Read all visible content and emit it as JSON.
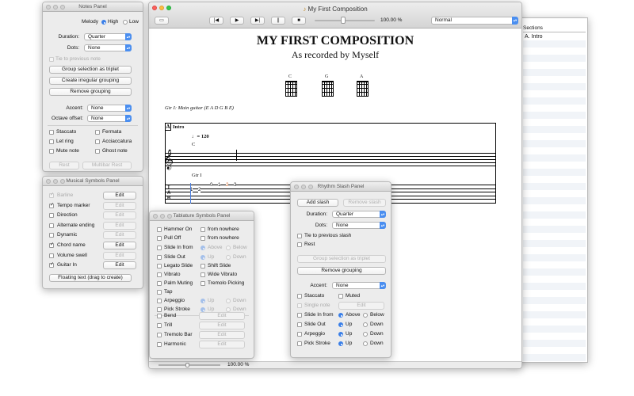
{
  "main": {
    "title": "My First Composition",
    "tempo": "100.00 %",
    "view": "Normal",
    "zoom": "100.00 %"
  },
  "score": {
    "title": "MY FIRST COMPOSITION",
    "subtitle": "As recorded by Myself",
    "chords": [
      "C",
      "G",
      "A"
    ],
    "track": "Gtr I: Main guitar (E A D G B E)",
    "section": "A",
    "section_name": "Intro",
    "tempo_mark": "♩= 120",
    "chord_c": "C",
    "staff_label": "Gtr I",
    "tab_letters": [
      "T",
      "A",
      "B"
    ],
    "frets": [
      "1",
      "2",
      "0",
      "1",
      "2",
      "3"
    ]
  },
  "sections": {
    "header": "Sections",
    "items": [
      "A. Intro"
    ]
  },
  "notes_panel": {
    "title": "Notes Panel",
    "melody": "Melody",
    "high": "High",
    "low": "Low",
    "duration": "Duration:",
    "duration_val": "Quarter",
    "dots": "Dots:",
    "dots_val": "None",
    "tie": "Tie to previous note",
    "group_triplet": "Group selection as triplet",
    "irregular": "Create irregular grouping",
    "remove": "Remove grouping",
    "accent": "Accent:",
    "accent_val": "None",
    "octave": "Octave offset:",
    "octave_val": "None",
    "staccato": "Staccato",
    "fermata": "Fermata",
    "letring": "Let ring",
    "acciaccatura": "Acciaccatura",
    "mute": "Mute note",
    "ghost": "Ghost note",
    "rest": "Rest",
    "multibar": "Multibar Rest"
  },
  "symbols_panel": {
    "title": "Musical Symbols Panel",
    "items": [
      "Barline",
      "Tempo marker",
      "Direction",
      "Alternate ending",
      "Dynamic",
      "Chord name",
      "Volume swell",
      "Guitar In"
    ],
    "edit": "Edit",
    "floating": "Floating text (drag to create)"
  },
  "tab_panel": {
    "title": "Tablature Symbols Panel",
    "hammer": "Hammer On",
    "from_nowhere": "from nowhere",
    "pull": "Pull Off",
    "from_nowhere2": "from nowhere",
    "slide_from": "Slide In from",
    "above": "Above",
    "below": "Below",
    "slide_out": "Slide Out",
    "up": "Up",
    "down": "Down",
    "legato": "Legato Slide",
    "shift": "Shift Slide",
    "vibrato": "Vibrato",
    "wide": "Wide Vibrato",
    "palm": "Palm Muting",
    "tremolo_picking": "Tremolo Picking",
    "tap": "Tap",
    "arpeggio": "Arpeggio",
    "up2": "Up",
    "down2": "Down",
    "pick": "Pick Stroke",
    "up3": "Up",
    "down3": "Down",
    "bend": "Bend",
    "trill": "Trill",
    "tremolo_bar": "Tremolo Bar",
    "harmonic": "Harmonic",
    "edit": "Edit"
  },
  "slash_panel": {
    "title": "Rhythm Slash Panel",
    "add": "Add slash",
    "remove_slash": "Remove slash",
    "duration": "Duration:",
    "duration_val": "Quarter",
    "dots": "Dots:",
    "dots_val": "None",
    "tie": "Tie to previous slash",
    "rest": "Rest",
    "group_triplet": "Group selection as triplet",
    "remove_grouping": "Remove grouping",
    "accent": "Accent:",
    "accent_val": "None",
    "staccato": "Staccato",
    "muted": "Muted",
    "single": "Single note",
    "edit": "Edit",
    "slide_in": "Slide In from",
    "above": "Above",
    "below": "Below",
    "slide_out": "Slide Out",
    "up": "Up",
    "down": "Down",
    "arpeggio": "Arpeggio",
    "up2": "Up",
    "down2": "Down",
    "pick": "Pick Stroke",
    "up3": "Up",
    "down3": "Down"
  }
}
